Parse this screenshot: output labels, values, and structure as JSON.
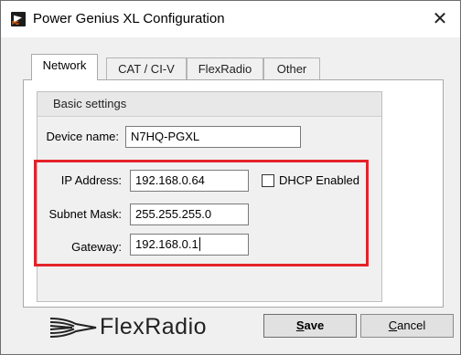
{
  "window": {
    "title": "Power Genius XL Configuration",
    "close_glyph": "✕"
  },
  "tabs": [
    {
      "label": "Network",
      "active": true
    },
    {
      "label": "CAT / CI-V",
      "active": false
    },
    {
      "label": "FlexRadio",
      "active": false
    },
    {
      "label": "Other",
      "active": false
    }
  ],
  "basic_settings": {
    "title": "Basic settings",
    "device_name_label": "Device name:",
    "device_name_value": "N7HQ-PGXL",
    "ip_address_label": "IP Address:",
    "ip_address_value": "192.168.0.64",
    "dhcp_label": "DHCP Enabled",
    "dhcp_checked": false,
    "subnet_mask_label": "Subnet Mask:",
    "subnet_mask_value": "255.255.255.0",
    "gateway_label": "Gateway:",
    "gateway_value": "192.168.0.1"
  },
  "footer": {
    "logo_text": "FlexRadio",
    "save_mnemonic": "S",
    "save_rest": "ave",
    "cancel_mnemonic": "C",
    "cancel_rest": "ancel"
  },
  "colors": {
    "highlight": "#e4222a",
    "window_bg": "#f0f0f0"
  }
}
